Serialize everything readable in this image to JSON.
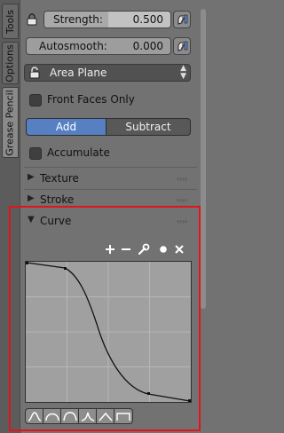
{
  "tabs": [
    {
      "label": "Tools",
      "active": false
    },
    {
      "label": "Options",
      "active": false
    },
    {
      "label": "Grease Pencil",
      "active": true
    }
  ],
  "strength": {
    "label": "Strength:",
    "value": "0.500",
    "icon": "lock-icon"
  },
  "autosmooth": {
    "label": "Autosmooth:",
    "value": "0.000"
  },
  "area_plane": {
    "value": "Area Plane",
    "icon": "open-lock-icon"
  },
  "front_faces_only": {
    "label": "Front Faces Only",
    "checked": false
  },
  "direction": {
    "add_label": "Add",
    "subtract_label": "Subtract",
    "selected": "Add"
  },
  "accumulate": {
    "label": "Accumulate",
    "checked": false
  },
  "panels": {
    "texture": {
      "title": "Texture",
      "expanded": false
    },
    "stroke": {
      "title": "Stroke",
      "expanded": false
    },
    "curve": {
      "title": "Curve",
      "expanded": true
    }
  },
  "curve_tools": [
    "add-point-icon",
    "remove-point-icon",
    "wrench-icon",
    "circle-icon",
    "delete-icon"
  ],
  "curve_presets": [
    "smooth-preset-icon",
    "sphere-preset-icon",
    "root-preset-icon",
    "sharp-preset-icon",
    "line-preset-icon",
    "max-preset-icon"
  ],
  "colors": {
    "active_button": "#5680c2",
    "highlight_box": "#e1141b",
    "panel_bg": "#727272",
    "curve_bg": "#a0a0a0"
  }
}
